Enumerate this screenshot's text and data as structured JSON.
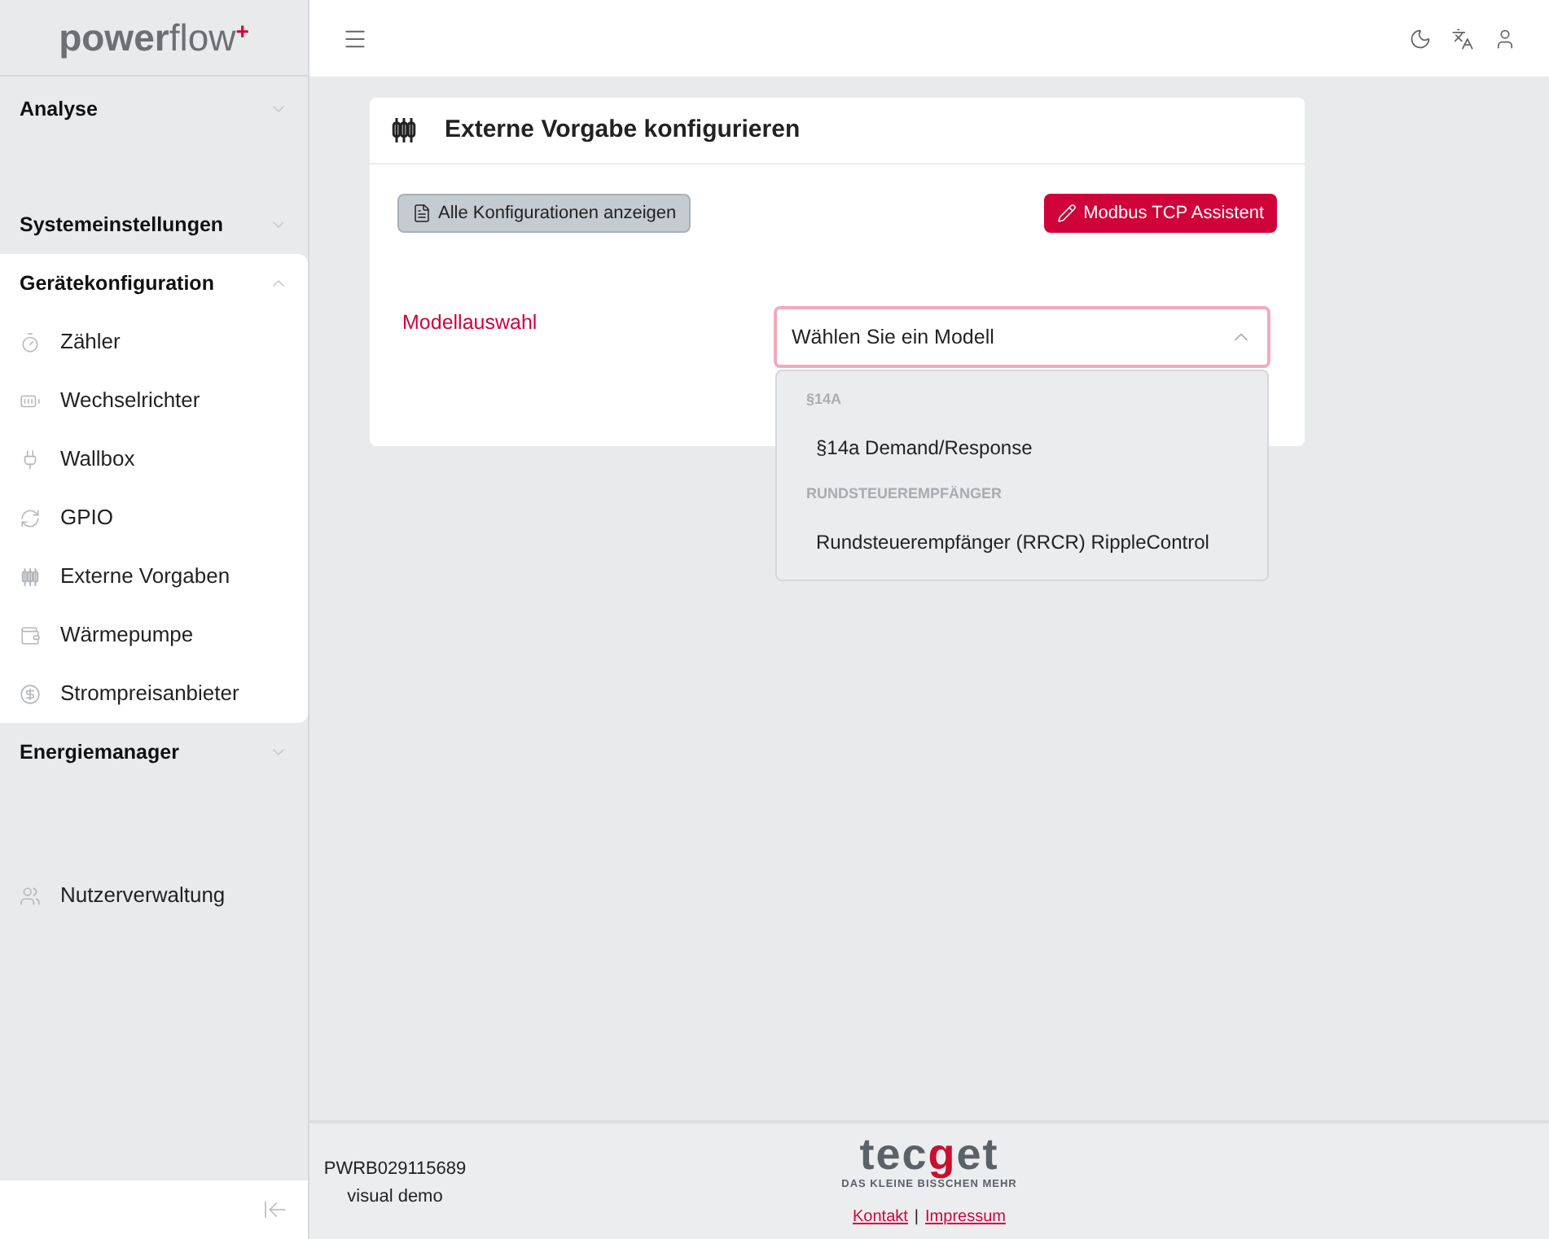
{
  "sidebar": {
    "logo": {
      "bold": "power",
      "light": "flow",
      "mark": "+"
    },
    "sections": [
      {
        "kind": "section",
        "label": "Analyse",
        "expanded": false
      },
      {
        "kind": "section",
        "label": "Systemeinstellungen",
        "expanded": false
      },
      {
        "kind": "section",
        "label": "Gerätekonfiguration",
        "expanded": true,
        "children": [
          {
            "label": "Zähler"
          },
          {
            "label": "Wechselrichter"
          },
          {
            "label": "Wallbox"
          },
          {
            "label": "GPIO"
          },
          {
            "label": "Externe Vorgaben"
          },
          {
            "label": "Wärmepumpe"
          },
          {
            "label": "Strompreisanbieter"
          }
        ]
      },
      {
        "kind": "section",
        "label": "Energiemanager",
        "expanded": false
      },
      {
        "kind": "link",
        "label": "Nutzerverwaltung"
      }
    ]
  },
  "card": {
    "title": "Externe Vorgabe konfigurieren",
    "secondary_button": "Alle Konfigurationen anzeigen",
    "primary_button": "Modbus TCP Assistent",
    "field_label": "Modellauswahl",
    "select": {
      "placeholder": "Wählen Sie ein Modell",
      "expanded": true,
      "groups": [
        {
          "label": "§14A",
          "options": [
            {
              "label": "§14a Demand/Response",
              "selected": false
            }
          ]
        },
        {
          "label": "RUNDSTEUEREMPFÄNGER",
          "options": [
            {
              "label": "Rundsteuerempfänger (RRCR) RippleControl",
              "selected": false
            }
          ]
        }
      ]
    }
  },
  "footer": {
    "serial": "PWRB029115689",
    "mode": "visual demo",
    "logo": {
      "before": "tec",
      "accent": "g",
      "after": "et",
      "tagline": "DAS KLEINE BISSCHEN MEHR"
    },
    "links": [
      "Kontakt",
      "Impressum"
    ],
    "separator": "|"
  }
}
